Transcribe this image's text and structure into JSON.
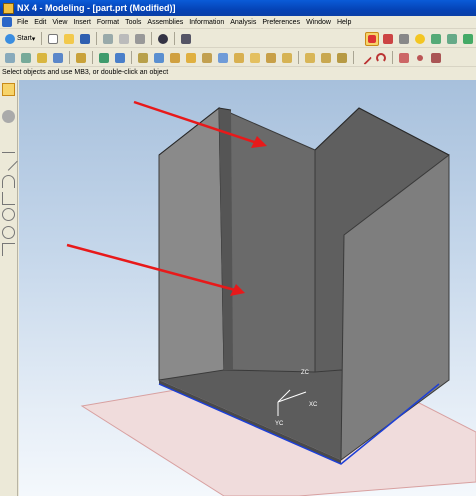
{
  "window": {
    "title": "NX 4 - Modeling - [part.prt (Modified)]"
  },
  "menu": [
    "File",
    "Edit",
    "View",
    "Insert",
    "Format",
    "Tools",
    "Assemblies",
    "Information",
    "Analysis",
    "Preferences",
    "Window",
    "Help"
  ],
  "toolbar": {
    "start_label": "Start",
    "dropdown_marker": "▾"
  },
  "cue_line": "Select objects and use MB3, or double-click an object",
  "triad": {
    "z": "ZC",
    "x": "XC",
    "y": "YC"
  },
  "colors": {
    "arrow": "#e8191a",
    "title": "#0543b6",
    "datum_plane": "#e6b8b8",
    "solid": "#6b6b6b",
    "edge_highlight": "#1d3fd6"
  }
}
